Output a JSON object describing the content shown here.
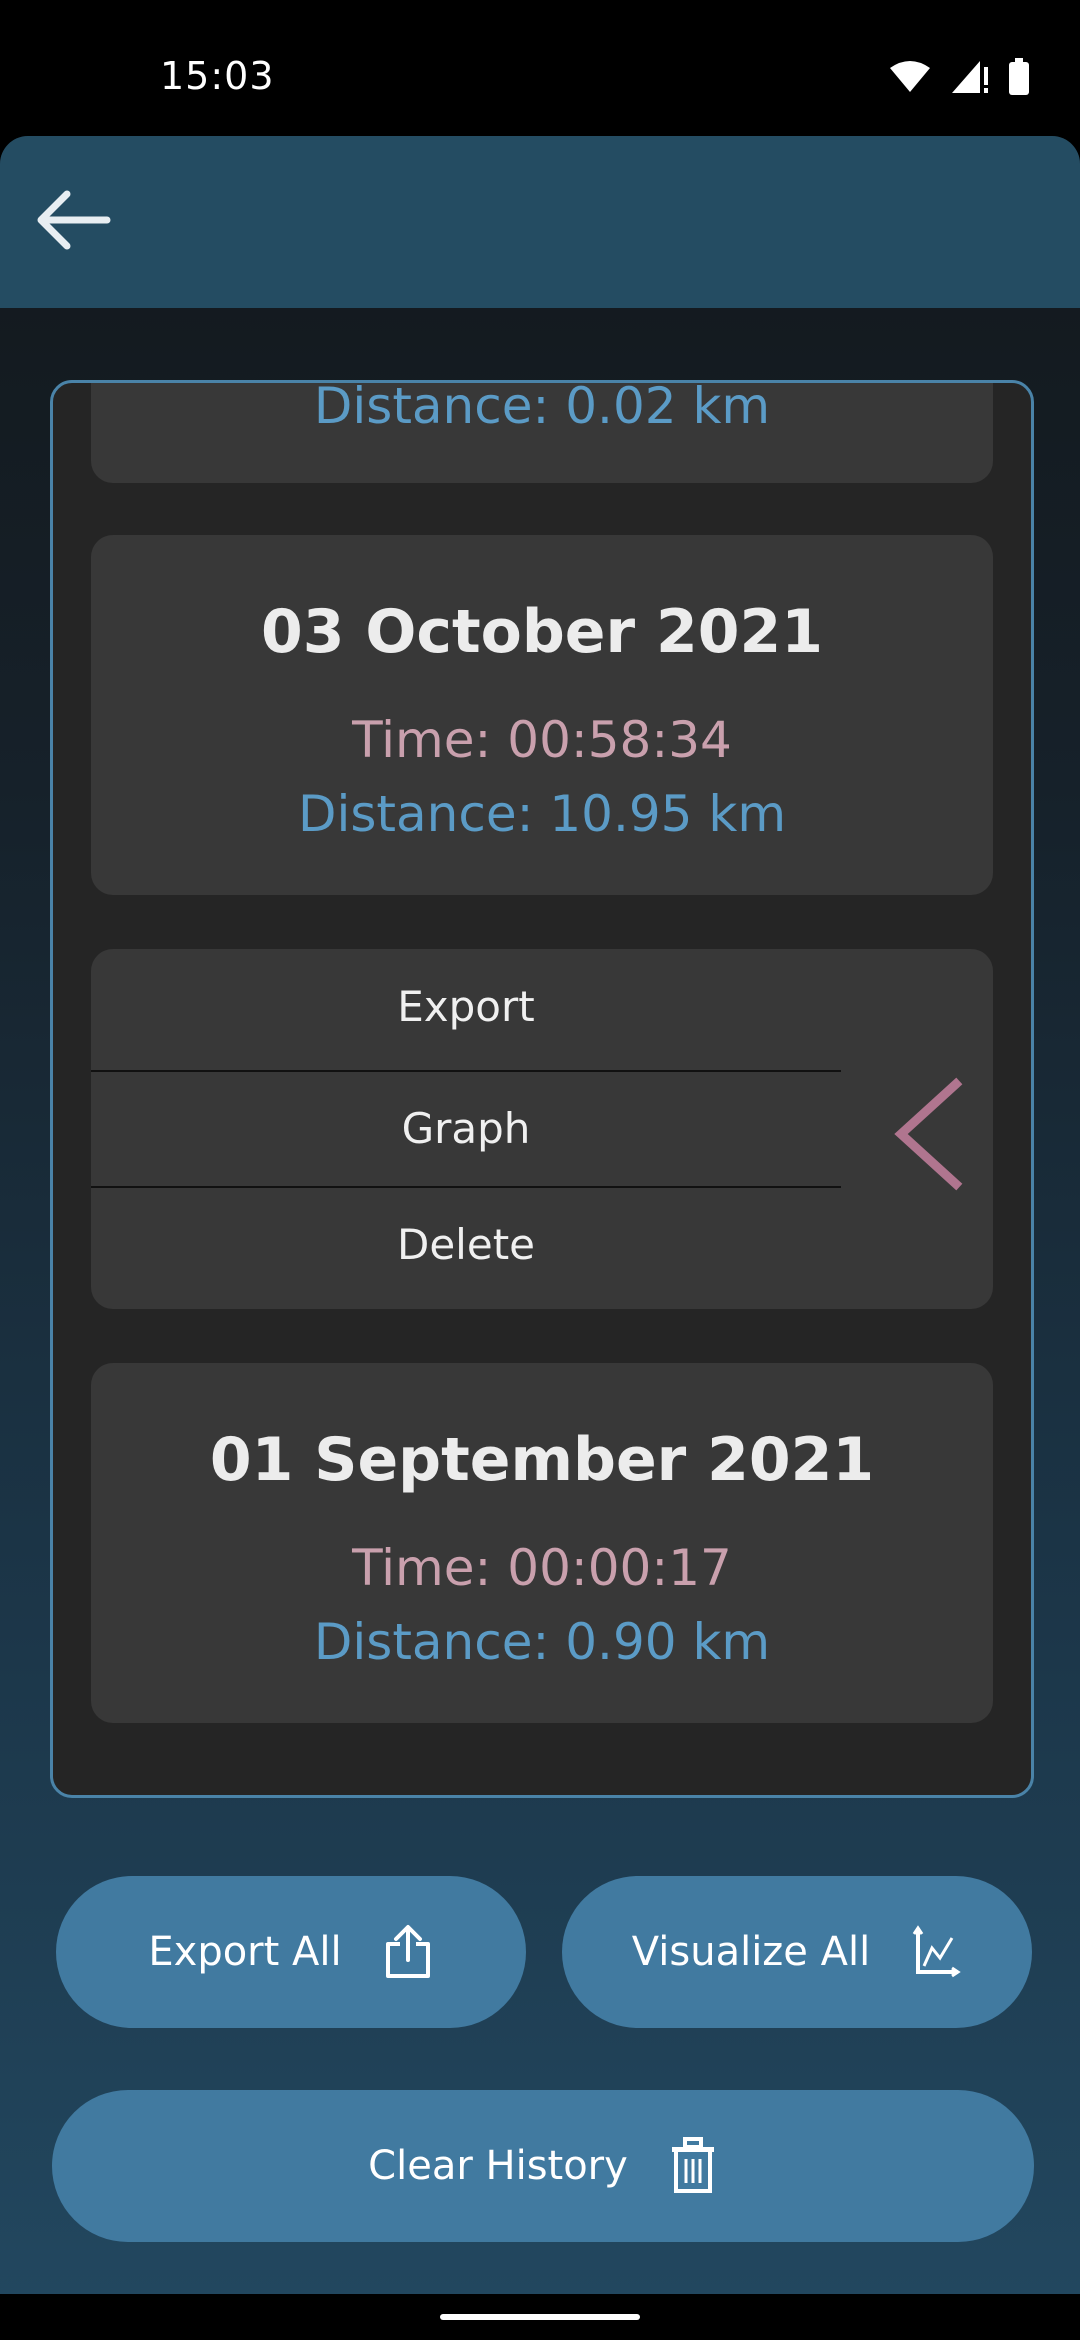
{
  "status_bar": {
    "time": "15:03"
  },
  "history": {
    "partial_card": {
      "distance": "Distance: 0.02 km"
    },
    "cards": [
      {
        "date": "03 October 2021",
        "time": "Time: 00:58:34",
        "distance": "Distance: 10.95 km"
      },
      {
        "date": "01 September 2021",
        "time": "Time: 00:00:17",
        "distance": "Distance: 0.90 km"
      }
    ],
    "menu": {
      "export": "Export",
      "graph": "Graph",
      "delete": "Delete"
    }
  },
  "buttons": {
    "export_all": "Export All",
    "visualize_all": "Visualize All",
    "clear_history": "Clear History"
  },
  "icons": {
    "back": "arrow-left-icon",
    "share": "share-icon",
    "chart": "chart-icon",
    "trash": "trash-icon",
    "chevron": "chevron-left-icon"
  },
  "colors": {
    "accent": "#417aa0",
    "app_bar": "#244c62",
    "time_text": "#c9a0ad",
    "distance_text": "#5b9bc6",
    "chevron": "#b0758f"
  }
}
